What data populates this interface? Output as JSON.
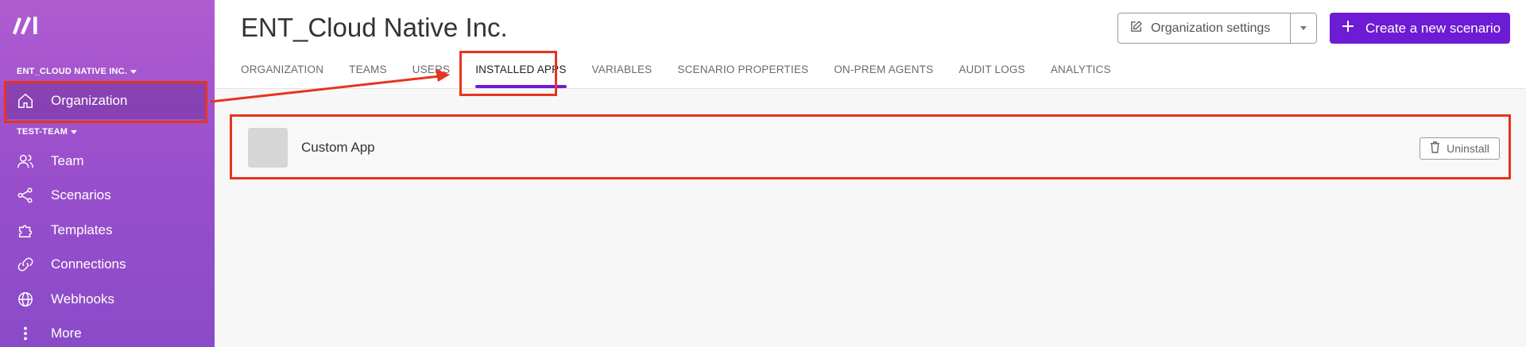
{
  "sidebar": {
    "org_label": "ENT_CLOUD NATIVE INC.",
    "team_label": "TEST-TEAM",
    "items": [
      {
        "label": "Organization",
        "icon": "home-icon"
      },
      {
        "label": "Team",
        "icon": "users-icon"
      },
      {
        "label": "Scenarios",
        "icon": "share-nodes-icon"
      },
      {
        "label": "Templates",
        "icon": "puzzle-icon"
      },
      {
        "label": "Connections",
        "icon": "link-icon"
      },
      {
        "label": "Webhooks",
        "icon": "globe-icon"
      },
      {
        "label": "More",
        "icon": "more-vertical-icon"
      }
    ]
  },
  "header": {
    "title": "ENT_Cloud Native Inc.",
    "org_settings_label": "Organization settings",
    "create_label": "Create a new scenario",
    "tabs": [
      {
        "label": "ORGANIZATION"
      },
      {
        "label": "TEAMS"
      },
      {
        "label": "USERS"
      },
      {
        "label": "INSTALLED APPS",
        "active": true
      },
      {
        "label": "VARIABLES"
      },
      {
        "label": "SCENARIO PROPERTIES"
      },
      {
        "label": "ON-PREM AGENTS"
      },
      {
        "label": "AUDIT LOGS"
      },
      {
        "label": "ANALYTICS"
      }
    ]
  },
  "apps": [
    {
      "name": "Custom App",
      "action_label": "Uninstall"
    }
  ],
  "colors": {
    "accent": "#6d1bd4",
    "sidebar_top": "#b05cd0",
    "sidebar_bottom": "#8a4bc8",
    "annotation": "#e8331d"
  }
}
